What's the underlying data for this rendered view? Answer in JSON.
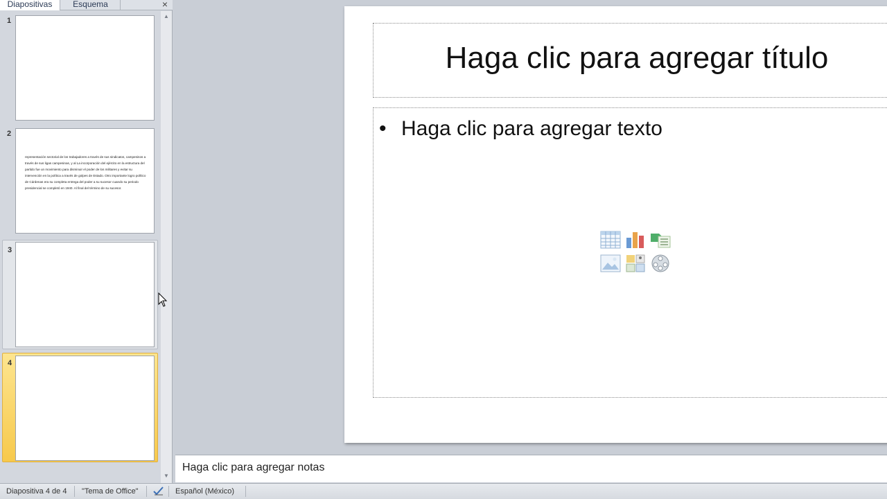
{
  "panel": {
    "tabs": [
      "Diapositivas",
      "Esquema"
    ],
    "close_glyph": "×",
    "thumbnails": [
      {
        "number": "1",
        "state": "normal",
        "text": ""
      },
      {
        "number": "2",
        "state": "normal",
        "text": "representación sectorial de los trabajadores a través de sus sindicatos, campesinos a través de sus ligas campesinas, y al La incorporación del ejército en la estructura del partido fue un movimiento para disminuir el poder de los militares y evitar su intervención en la política a través de golpes de Estado. Otro importante logro político de Cárdenas era su completa entrega del poder a su sucesor cuando su periodo presidencial se completó en 1940. Al final del término de su sucesor."
      },
      {
        "number": "3",
        "state": "hover",
        "text": ""
      },
      {
        "number": "4",
        "state": "selected",
        "text": ""
      }
    ],
    "scroll_up": "▲",
    "scroll_down": "▼"
  },
  "slide": {
    "title": "Haga clic para agregar título",
    "bullet": "•",
    "body": "Haga clic para agregar texto",
    "insert_icons": [
      "table-icon",
      "chart-icon",
      "smartart-icon",
      "picture-icon",
      "clipart-icon",
      "media-icon"
    ]
  },
  "notes": {
    "placeholder": "Haga clic para agregar notas"
  },
  "status": {
    "slide_counter": "Diapositiva 4 de 4",
    "theme": "\"Tema de Office\"",
    "language": "Español (México)"
  },
  "colors": {
    "selected_thumb": "#f7c94c",
    "panel_bg": "#d3d7de",
    "workspace_bg": "#c9ced6"
  }
}
